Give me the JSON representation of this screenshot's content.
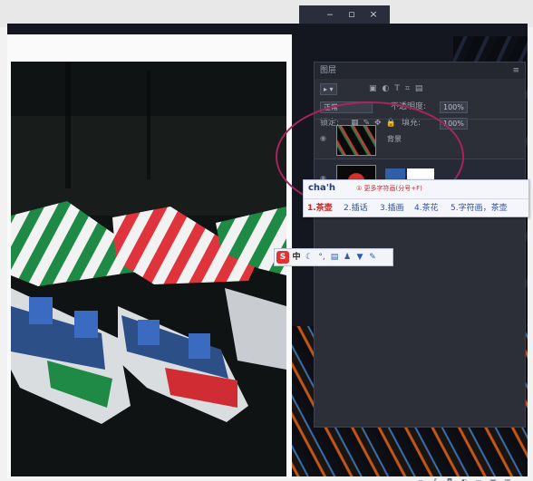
{
  "window": {
    "minimize_icon": "minus",
    "restore_icon": "square",
    "close_icon": "x"
  },
  "panel": {
    "tabs": [
      "图层"
    ],
    "blend_mode": "正常",
    "opacity_label": "不透明度:",
    "opacity_value": "100%",
    "lock_label": "锁定:",
    "fill_label": "填充:",
    "fill_value": "100%",
    "layers": [
      {
        "name": "背景",
        "selected": false
      },
      {
        "name": "",
        "selected": true
      }
    ]
  },
  "ime": {
    "pinyin": "cha'h",
    "hint": "① 更多字符画(分号+F)",
    "candidates": [
      "1.茶壶",
      "2.插话",
      "3.插画",
      "4.茶花",
      "5.字符画，茶壶"
    ]
  },
  "ime_toolbar": {
    "logo": "S",
    "mode": "中"
  },
  "colors": {
    "accent_circle": "#a8245f",
    "panel_bg": "#2c2f38",
    "selected_layer": "#2f5fa8"
  }
}
